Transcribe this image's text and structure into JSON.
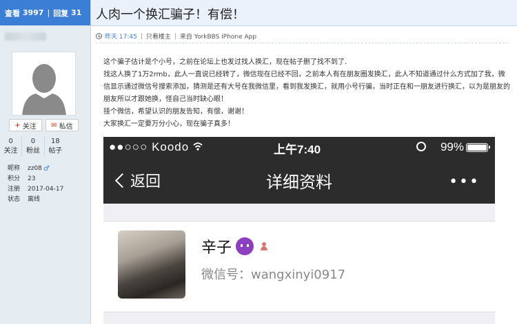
{
  "stats": {
    "views_label": "查看",
    "views": "3997",
    "sep": "|",
    "replies_label": "回复",
    "replies": "31"
  },
  "author": {
    "follow": "关注",
    "message": "私信",
    "counts": [
      {
        "n": "0",
        "label": "关注"
      },
      {
        "n": "0",
        "label": "粉丝"
      },
      {
        "n": "18",
        "label": "帖子"
      }
    ],
    "info": [
      {
        "k": "昵称",
        "v": "zz08"
      },
      {
        "k": "积分",
        "v": "23"
      },
      {
        "k": "注册",
        "v": "2017-04-17"
      },
      {
        "k": "状态",
        "v": "离线"
      }
    ]
  },
  "post": {
    "title": "人肉一个换汇骗子！有偿！",
    "time": "昨天 17:45",
    "only_author": "只看楼主",
    "source": "来自 YorkBBS iPhone App",
    "paragraphs": [
      "这个骗子估计是个小号，之前在论坛上也发过找人换汇，现在帖子删了找不到了.",
      "找这人换了1万2rmb，此人一直说已经转了，微信现在已经不回，之前本人有在朋友圈发换汇，此人不知道通过什么方式加了我，微信显示通过微信号搜索添加，猜测是还有大号在我微信里，看到我发换汇，就用小号行骗，当时正在和一朋友进行换汇，以为是朋友的朋友所以才跟她换，怪自己当时缺心眼！",
      "挂个微信，希望认识的朋友告知，有偿，谢谢！",
      "大家换汇一定要万分小心，现在骗子真多！"
    ]
  },
  "screenshot": {
    "carrier": "●●○○○ Koodo",
    "time": "上午7:40",
    "battery": "99%",
    "back": "返回",
    "title": "详细资料",
    "more": "•••",
    "nickname": "辛子",
    "wechat_id": "微信号：wangxinyi0917"
  }
}
